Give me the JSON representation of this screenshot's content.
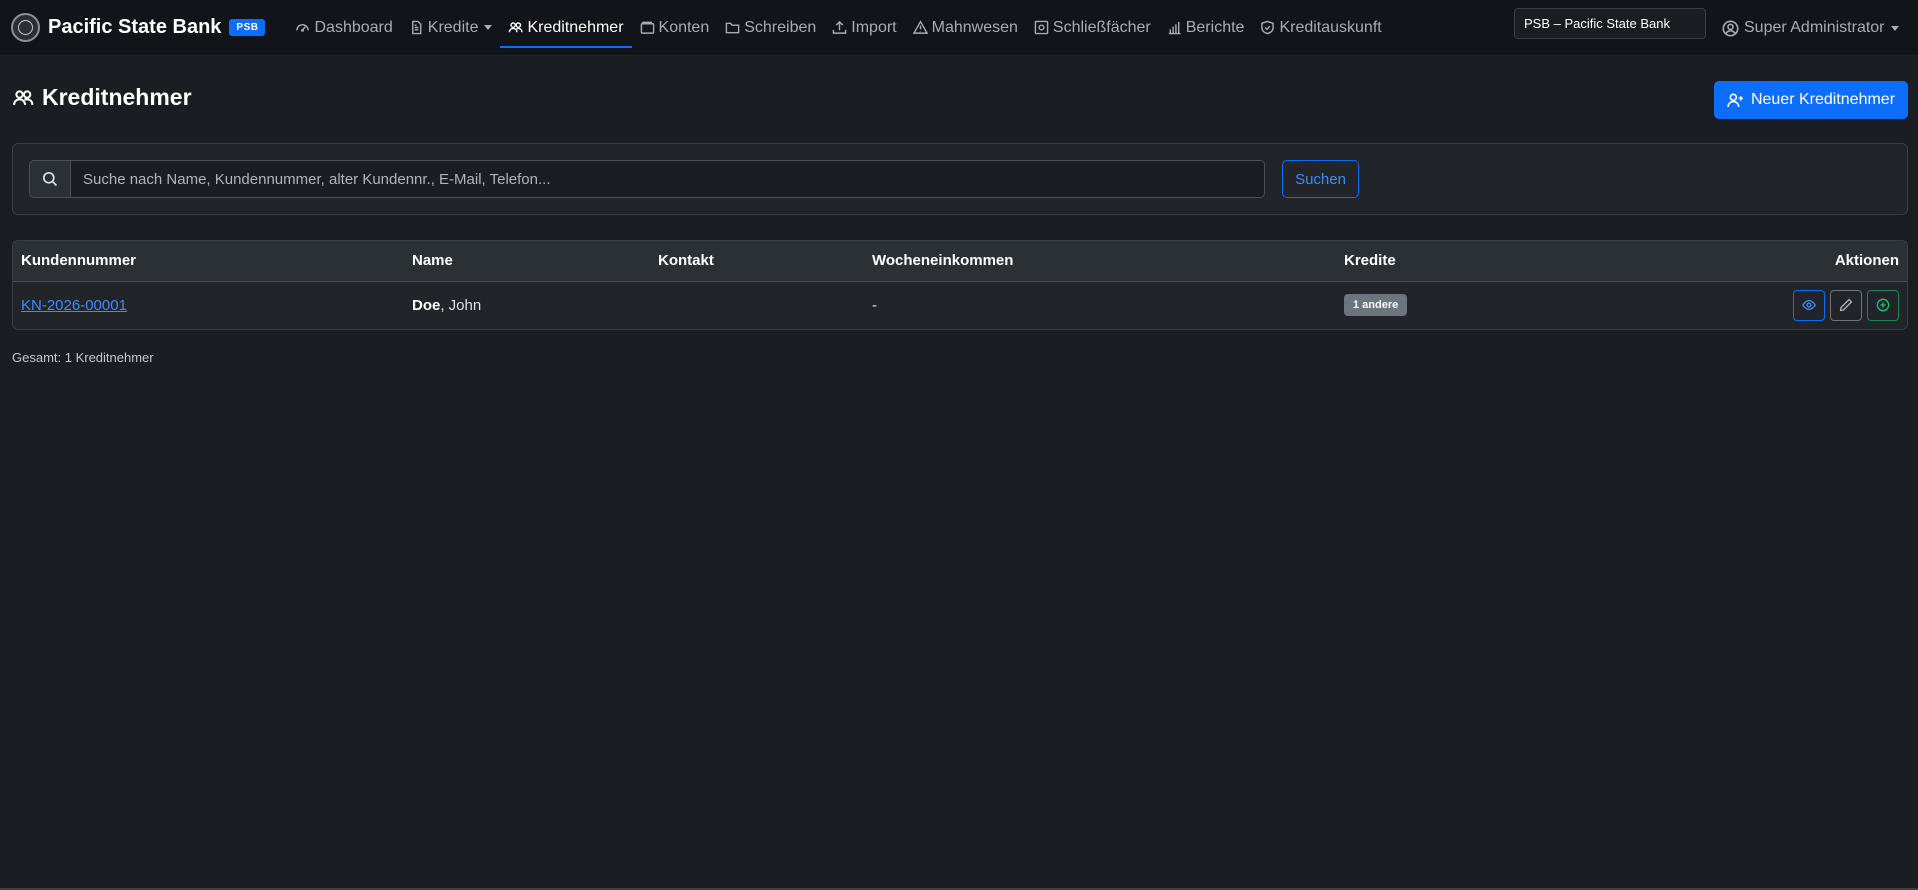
{
  "brand": {
    "name": "Pacific State Bank",
    "badge": "PSB"
  },
  "nav": [
    {
      "label": "Dashboard",
      "icon": "speedometer-icon"
    },
    {
      "label": "Kredite",
      "icon": "document-icon",
      "dropdown": true
    },
    {
      "label": "Kreditnehmer",
      "icon": "people-icon",
      "active": true
    },
    {
      "label": "Konten",
      "icon": "wallet-icon"
    },
    {
      "label": "Schreiben",
      "icon": "folder-icon"
    },
    {
      "label": "Import",
      "icon": "upload-icon"
    },
    {
      "label": "Mahnwesen",
      "icon": "warning-icon"
    },
    {
      "label": "Schließfächer",
      "icon": "safe-icon"
    },
    {
      "label": "Berichte",
      "icon": "bar-chart-icon"
    },
    {
      "label": "Kreditauskunft",
      "icon": "shield-icon"
    }
  ],
  "bank_select": {
    "value": "PSB – Pacific State Bank"
  },
  "user": {
    "name": "Super Administrator"
  },
  "page": {
    "title": "Kreditnehmer",
    "new_button": "Neuer Kreditnehmer"
  },
  "search": {
    "placeholder": "Suche nach Name, Kundennummer, alter Kundennr., E-Mail, Telefon...",
    "button": "Suchen"
  },
  "table": {
    "headers": {
      "kundennummer": "Kundennummer",
      "name": "Name",
      "kontakt": "Kontakt",
      "wocheneinkommen": "Wocheneinkommen",
      "kredite": "Kredite",
      "aktionen": "Aktionen"
    },
    "rows": [
      {
        "kundennummer": "KN-2026-00001",
        "last_name": "Doe",
        "first_name": ", John",
        "kontakt": "",
        "wocheneinkommen": "-",
        "kredite": "1 andere"
      }
    ]
  },
  "total": "Gesamt: 1 Kreditnehmer",
  "colors": {
    "accent": "#0d6efd",
    "background": "#1a1d21",
    "success": "#198754",
    "secondary": "#6c757d"
  }
}
